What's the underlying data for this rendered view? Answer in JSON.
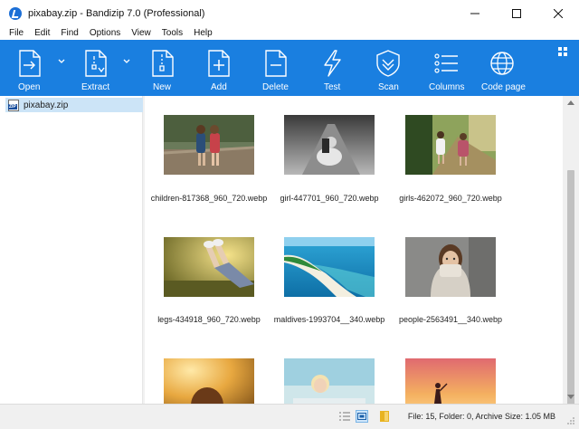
{
  "window": {
    "title": "pixabay.zip - Bandizip 7.0 (Professional)",
    "controls": [
      "minimize-icon",
      "maximize-icon",
      "close-icon"
    ]
  },
  "menu": [
    "File",
    "Edit",
    "Find",
    "Options",
    "View",
    "Tools",
    "Help"
  ],
  "toolbar": {
    "accent": "#1a7fe0",
    "buttons": [
      {
        "id": "open",
        "label": "Open",
        "icon": "open-icon",
        "dropdown": true
      },
      {
        "id": "extract",
        "label": "Extract",
        "icon": "extract-icon",
        "dropdown": true
      },
      {
        "id": "new",
        "label": "New",
        "icon": "new-archive-icon"
      },
      {
        "id": "add",
        "label": "Add",
        "icon": "add-file-icon"
      },
      {
        "id": "delete",
        "label": "Delete",
        "icon": "delete-file-icon"
      },
      {
        "id": "test",
        "label": "Test",
        "icon": "test-lightning-icon"
      },
      {
        "id": "scan",
        "label": "Scan",
        "icon": "shield-scan-icon"
      },
      {
        "id": "columns",
        "label": "Columns",
        "icon": "columns-list-icon"
      },
      {
        "id": "codepage",
        "label": "Code page",
        "icon": "globe-icon"
      }
    ]
  },
  "tree": {
    "items": [
      {
        "label": "pixabay.zip",
        "icon": "zip-archive-icon",
        "selected": true
      }
    ]
  },
  "files": [
    {
      "name": "children-817368_960_720.webp"
    },
    {
      "name": "girl-447701_960_720.webp"
    },
    {
      "name": "girls-462072_960_720.webp"
    },
    {
      "name": "legs-434918_960_720.webp"
    },
    {
      "name": "maldives-1993704__340.webp"
    },
    {
      "name": "people-2563491__340.webp"
    },
    {
      "name": ""
    },
    {
      "name": ""
    },
    {
      "name": ""
    }
  ],
  "status": {
    "text": "File: 15, Folder: 0, Archive Size: 1.05 MB",
    "views": [
      "details-view-icon",
      "thumbnail-view-icon",
      "preview-pane-icon"
    ],
    "active_view": "thumbnail-view-icon"
  }
}
